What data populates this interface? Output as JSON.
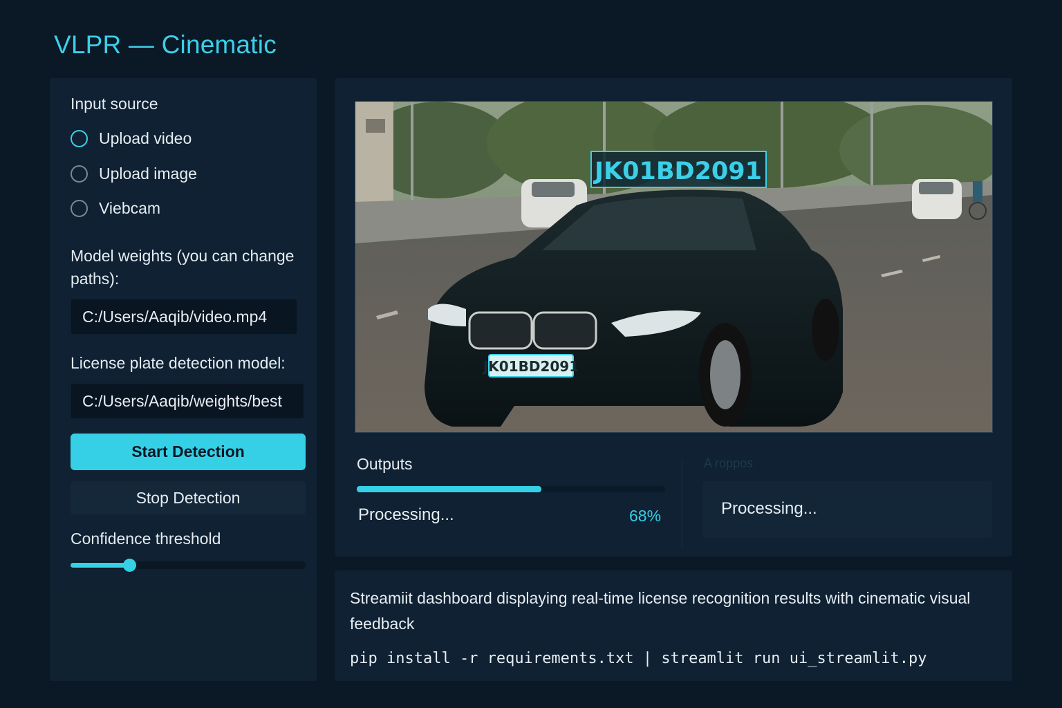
{
  "app": {
    "title": "VLPR — Cinematic"
  },
  "sidebar": {
    "input_source_label": "Input source",
    "radio_options": [
      {
        "label": "Upload video",
        "selected": true
      },
      {
        "label": "Upload image",
        "selected": false
      },
      {
        "label": "Viebcam",
        "selected": false
      }
    ],
    "model_weights_label": "Model weights (you can change paths):",
    "model_weights_value": "C:/Users/Aaqib/video.mp4",
    "plate_model_label": "License plate detection model:",
    "plate_model_value": "C:/Users/Aaqib/weights/best",
    "start_button": "Start Detection",
    "stop_button": "Stop Detection",
    "confidence_label": "Confidence threshold",
    "confidence_fraction": 0.25
  },
  "video": {
    "detected_plate_overlay": "JK01BD2091",
    "plate_text": "JK01BD2091"
  },
  "outputs": {
    "label": "Outputs",
    "progress_percent": 68,
    "progress_label": "68%",
    "status_left": "Processing...",
    "faded_title": "A roppos",
    "status_right": "Processing..."
  },
  "footer": {
    "description": "Streamiit dashboard displaying real-time license recognition results with cinematic visual feedback",
    "command": "pip install -r requirements.txt | streamlit run ui_streamlit.py"
  },
  "colors": {
    "accent": "#36d0e6",
    "background": "#0b1826",
    "panel": "#0f2132"
  }
}
